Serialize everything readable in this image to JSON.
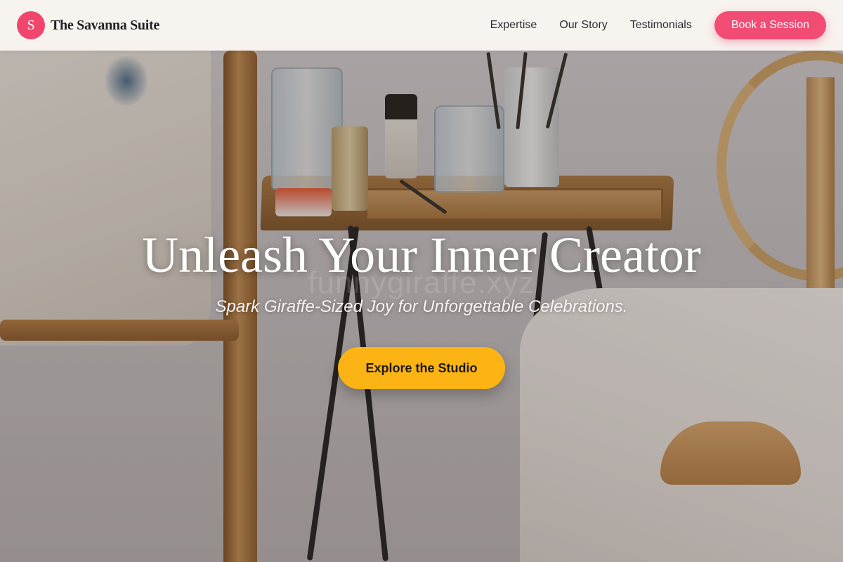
{
  "brand": {
    "logo_letter": "S",
    "name": "The Savanna Suite"
  },
  "nav": {
    "links": [
      "Expertise",
      "Our Story",
      "Testimonials"
    ],
    "cta_label": "Book a Session"
  },
  "hero": {
    "title": "Unleash Your Inner Creator",
    "subtitle": "Spark Giraffe-Sized Joy for Unforgettable Celebrations.",
    "watermark": "funnygiraffe.xyz",
    "cta_label": "Explore the Studio"
  },
  "colors": {
    "brand_accent": "#f24b74",
    "cta_primary": "#fcb414",
    "nav_background": "#faf6f0",
    "text_dark": "#232325"
  },
  "icons": {
    "logo": "letter-s-circle-logo"
  }
}
